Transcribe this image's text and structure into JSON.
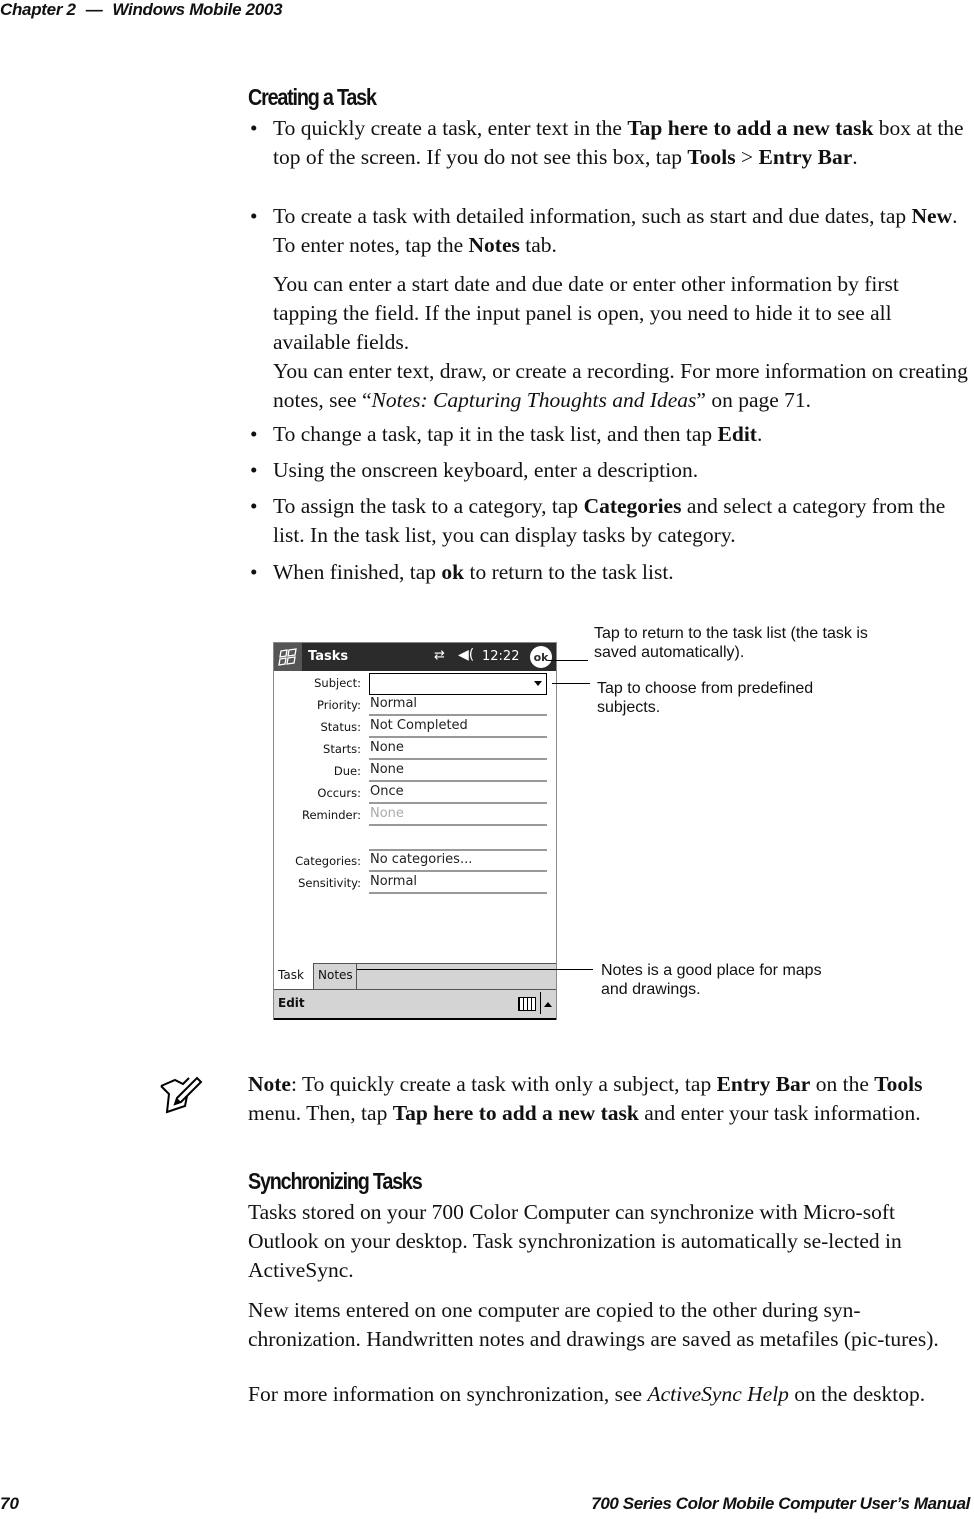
{
  "header": {
    "chapter": "Chapter 2",
    "dash": "—",
    "title": "Windows Mobile 2003"
  },
  "section1": {
    "heading": "Creating a Task",
    "bullet1": {
      "a": "To quickly create a task, enter text in the ",
      "b1": "Tap here to add a new task",
      "c": " box at the top of the screen. If you do not see this box, tap ",
      "b2": "Tools",
      "d": " > ",
      "b3": "Entry Bar",
      "e": "."
    },
    "bullet2": {
      "a": "To create a task with detailed information, such as start and due dates, tap ",
      "b1": "New",
      "c": ". To enter notes, tap the ",
      "b2": "Notes",
      "d": " tab."
    },
    "para1": "You can enter a start date and due date or enter other information by first tapping the field. If the input panel is open, you need to hide it to see all available fields.",
    "para2": {
      "a": "You can enter text, draw, or create a recording. For more information on creating notes, see “",
      "i": "Notes: Capturing Thoughts and Ideas",
      "c": "” on page 71."
    },
    "bullet3": {
      "a": "To change a task, tap it in the task list, and then tap ",
      "b": "Edit",
      "c": "."
    },
    "bullet4": "Using the onscreen keyboard, enter a description.",
    "bullet5": {
      "a": "To assign the task to a category, tap ",
      "b": "Categories",
      "c": " and select a category from the list. In the task list, you can display tasks by category."
    },
    "bullet6": {
      "a": "When finished, tap ",
      "b": "ok",
      "c": " to return to the task list."
    },
    "bullet_glyph": "•"
  },
  "device": {
    "app_title": "Tasks",
    "sync_icon": "⇄",
    "volume_icon": "◀(",
    "time": "12:22",
    "ok_label": "ok",
    "fields": [
      {
        "label": "Subject:",
        "value": ""
      },
      {
        "label": "Priority:",
        "value": "Normal"
      },
      {
        "label": "Status:",
        "value": "Not Completed"
      },
      {
        "label": "Starts:",
        "value": "None"
      },
      {
        "label": "Due:",
        "value": "None"
      },
      {
        "label": "Occurs:",
        "value": "Once"
      },
      {
        "label": "Reminder:",
        "value": "None"
      },
      {
        "label": "Categories:",
        "value": "No categories..."
      },
      {
        "label": "Sensitivity:",
        "value": "Normal"
      }
    ],
    "tabs": [
      "Task",
      "Notes"
    ],
    "menu_edit": "Edit"
  },
  "callouts": {
    "ok": "Tap to return to the task list (the task is saved automatically).",
    "subject": "Tap to choose from predefined subjects.",
    "notes": "Notes is a good place for maps and drawings."
  },
  "note": {
    "label": "Note",
    "a": ": To quickly create a task with only a subject, tap ",
    "b1": "Entry Bar",
    "c": " on the ",
    "b2": "Tools",
    "d": " menu. Then, tap ",
    "b3": "Tap here to add a new task",
    "e": " and enter your task information."
  },
  "section2": {
    "heading": "Synchronizing Tasks",
    "para1": "Tasks stored on your 700 Color Computer can synchronize with Micro-soft Outlook on your desktop. Task synchronization is automatically se-lected in ActiveSync.",
    "para2": "New items entered on one computer are copied to the other during syn-chronization. Handwritten notes and drawings are saved as metafiles (pic-tures).",
    "para3": {
      "a": "For more information on synchronization, see ",
      "i": "ActiveSync Help",
      "c": " on the desktop."
    }
  },
  "footer": {
    "page": "70",
    "manual": "700 Series Color Mobile Computer User’s Manual"
  }
}
